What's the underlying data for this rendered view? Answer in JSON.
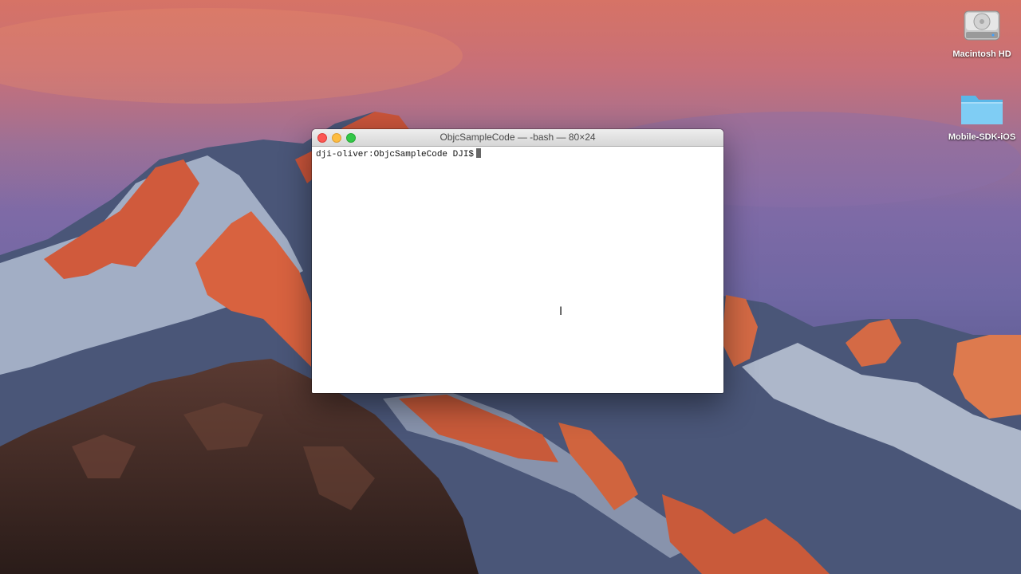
{
  "terminal": {
    "window_title": "ObjcSampleCode — -bash — 80×24",
    "prompt": "dji-oliver:ObjcSampleCode DJI$",
    "cursor_glyph": "I"
  },
  "desktop": {
    "icons": [
      {
        "label": "Macintosh HD",
        "icon": "hard-drive-icon"
      },
      {
        "label": "Mobile-SDK-iOS",
        "icon": "folder-icon"
      }
    ]
  },
  "colors": {
    "close": "#fc5753",
    "minimize": "#fdbc40",
    "zoom": "#33c748"
  }
}
